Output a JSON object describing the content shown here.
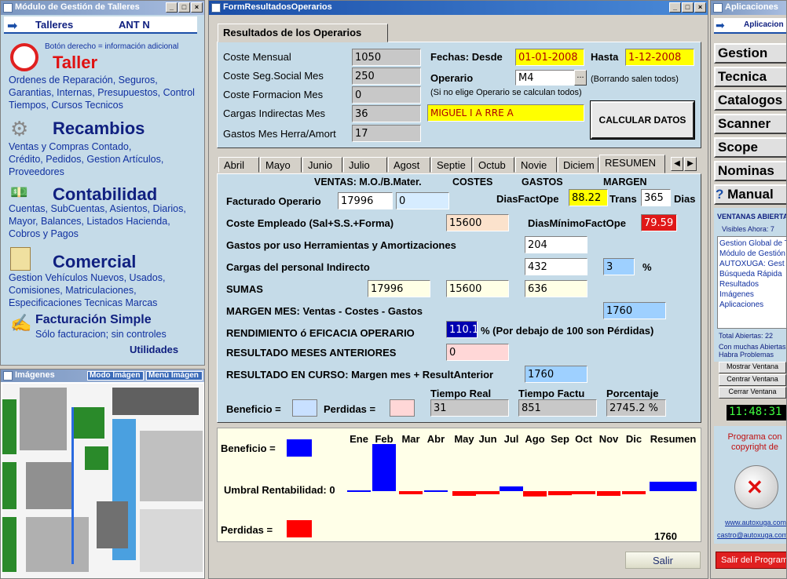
{
  "left_window": {
    "title": "Módulo de Gestión de Talleres",
    "header_label": "Talleres",
    "header_user": "ANT N",
    "hint": "Botón derecho = información adicional",
    "sections": [
      {
        "title": "Taller",
        "text": "Ordenes de Reparación, Seguros, Garantias, Internas, Presupuestos, Control Tiempos, Cursos Tecnicos"
      },
      {
        "title": "Recambios",
        "text": "Ventas y Compras Contado, Crédito, Pedidos, Gestion Artículos, Proveedores"
      },
      {
        "title": "Contabilidad",
        "text": "Cuentas, SubCuentas, Asientos, Diarios, Mayor, Balances, Listados Hacienda, Cobros y Pagos"
      },
      {
        "title": "Comercial",
        "text": "Gestion Vehículos Nuevos, Usados, Comisiones, Matriculaciones, Especificaciones Tecnicas Marcas"
      },
      {
        "title": "Facturación Simple",
        "text": "Sólo facturacion; sin controles"
      }
    ],
    "utilities": "Utilidades"
  },
  "images_window": {
    "title": "Imágenes",
    "mode_label": "Modo Imágen",
    "menu_label": "Menú Imágen"
  },
  "main_window": {
    "title": "FormResultadosOperarios",
    "tab_title": "Resultados de los Operarios",
    "costs": [
      {
        "label": "Coste Mensual",
        "value": "1050"
      },
      {
        "label": "Coste Seg.Social Mes",
        "value": "250"
      },
      {
        "label": "Coste Formacion Mes",
        "value": "0"
      },
      {
        "label": "Cargas Indirectas Mes",
        "value": "36"
      },
      {
        "label": "Gastos Mes Herra/Amort",
        "value": "17"
      }
    ],
    "fechas_label": "Fechas: Desde",
    "desde": "01-01-2008",
    "hasta_label": "Hasta",
    "hasta": "1-12-2008",
    "operario_label": "Operario",
    "operario": "M4",
    "operario_btn": "...",
    "borrando_note": "(Borrando salen todos)",
    "no_elige_note": "(Si no elige Operario se calculan todos)",
    "operario_name": "MIGUEL   I    A      RRE    A",
    "calc_button": "CALCULAR DATOS",
    "month_tabs": [
      "Abril",
      "Mayo",
      "Junio",
      "Julio",
      "Agost",
      "Septie",
      "Octub",
      "Novie",
      "Diciem",
      "RESUMEN"
    ],
    "hdr_ventas": "VENTAS: M.O./B.Mater.",
    "hdr_costes": "COSTES",
    "hdr_gastos": "GASTOS",
    "hdr_margen": "MARGEN",
    "facturado_label": "Facturado Operario",
    "facturado_mo": "17996",
    "facturado_bm": "0",
    "diasfact_label": "DiasFactOpe",
    "diasfact": "88.22",
    "trans_label": "Trans",
    "trans": "365",
    "dias_label": "Dias",
    "coste_label": "Coste Empleado (Sal+S.S.+Forma)",
    "coste_val": "15600",
    "diasmin_label": "DiasMínimoFactOpe",
    "diasmin": "79.59",
    "gastos_label": "Gastos por uso Herramientas y Amortizaciones",
    "gastos_val": "204",
    "cargas_label": "Cargas del personal Indirecto",
    "cargas_val": "432",
    "cargas_pct": "3",
    "pct_sign": "%",
    "sumas_label": "SUMAS",
    "sumas_ventas": "17996",
    "sumas_costes": "15600",
    "sumas_gastos": "636",
    "margen_label": "MARGEN MES: Ventas - Costes - Gastos",
    "margen_val": "1760",
    "rend_label": "RENDIMIENTO ó EFICACIA OPERARIO",
    "rend_val": "110.1",
    "rend_note": "% (Por debajo de 100 son Pérdidas)",
    "resant_label": "RESULTADO MESES ANTERIORES",
    "resant_val": "0",
    "rescurso_label": "RESULTADO EN CURSO: Margen mes + ResultAnterior",
    "rescurso_val": "1760",
    "tiempo_real_label": "Tiempo Real",
    "tiempo_factu_label": "Tiempo Factu",
    "porcentaje_label": "Porcentaje",
    "beneficio_label": "Beneficio =",
    "perdidas_label": "Perdidas =",
    "tiempo_real": "31",
    "tiempo_factu": "851",
    "porcentaje": "2745.2",
    "porcentaje_sign": "%",
    "salir": "Salir"
  },
  "chart_data": {
    "type": "bar",
    "categories": [
      "Ene",
      "Feb",
      "Mar",
      "Abr",
      "May",
      "Jun",
      "Jul",
      "Ago",
      "Sep",
      "Oct",
      "Nov",
      "Dic",
      "Resumen"
    ],
    "values": [
      0,
      1760,
      -100,
      0,
      -150,
      -100,
      50,
      -170,
      -130,
      -100,
      -150,
      -100,
      400
    ],
    "beneficio_label": "Beneficio =",
    "umbral_label": "Umbral Rentabilidad: 0",
    "perdidas_label": "Perdidas =",
    "resumen_value": "1760",
    "colors": {
      "positive": "#0000ff",
      "negative": "#ff0000"
    }
  },
  "right_window": {
    "title": "Aplicaciones",
    "header": "Aplicacion",
    "buttons": [
      "Gestion",
      "Tecnica",
      "Catalogos",
      "Scanner",
      "Scope",
      "Nominas",
      "Manual"
    ],
    "open_title": "VENTANAS ABIERTAS",
    "visibles": "Visibles Ahora: 7",
    "open_list": [
      "Gestion Global de T",
      "Módulo de Gestión",
      "AUTOXUGA: Gest",
      "Búsqueda Rápida",
      "Resultados",
      "Imágenes",
      "Aplicaciones"
    ],
    "total": "Total Abiertas: 22",
    "warning": "Con muchas Abiertas Habra Problemas",
    "btn_mostrar": "Mostrar Ventana",
    "btn_centrar": "Centrar Ventana",
    "btn_cerrar": "Cerrar Ventana",
    "clock": "11:48:31",
    "copyright": "Programa con copyright de",
    "web": "www.autoxuga.com",
    "email": "castro@autoxuga.com",
    "exit": "Salir del Programa"
  }
}
